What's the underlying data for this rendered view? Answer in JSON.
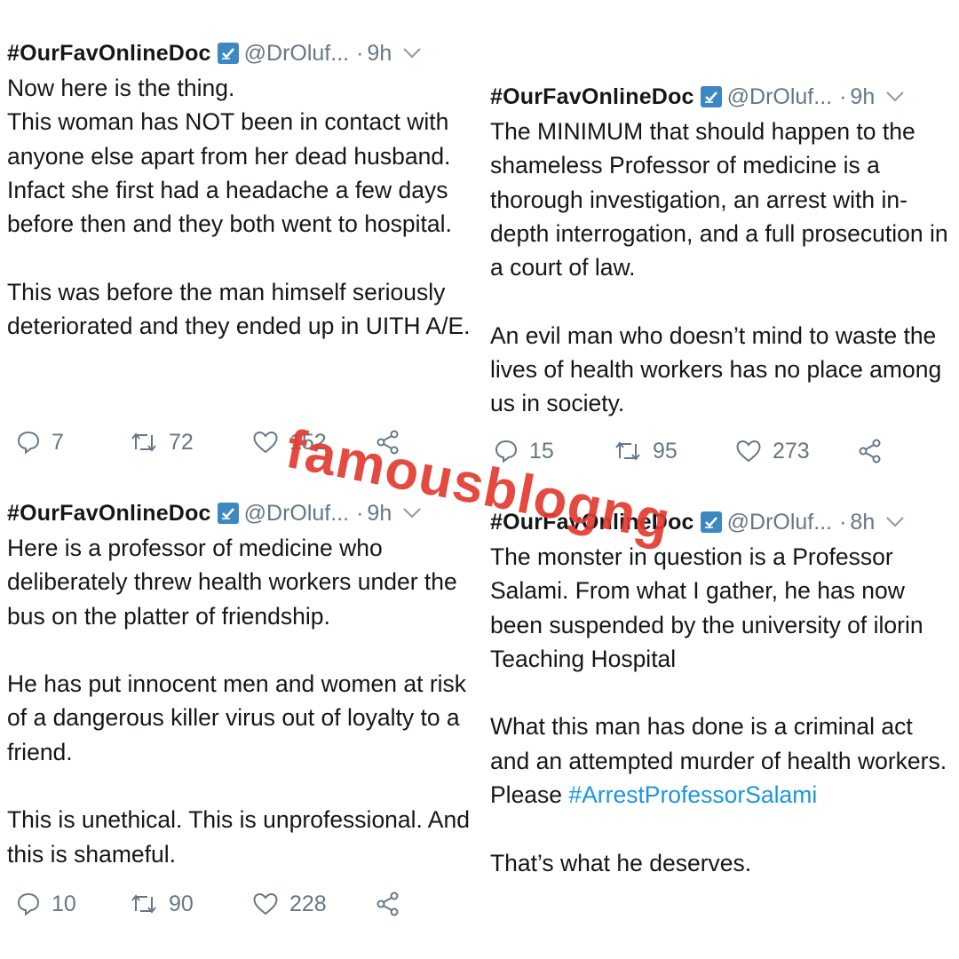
{
  "tweets": [
    {
      "name": "#OurFavOnlineDoc",
      "handle": "@DrOluf...",
      "separator": "·",
      "time": "9h",
      "paragraphs": [
        "Now here is the thing.\nThis woman has NOT been in contact with anyone else apart from her dead husband. Infact she first had a headache a few days before then and they both went to hospital.",
        "This was before the man himself seriously deteriorated and they ended up in UITH A/E."
      ],
      "replies": "7",
      "retweets": "72",
      "likes": "152"
    },
    {
      "name": "#OurFavOnlineDoc",
      "handle": "@DrOluf...",
      "separator": "·",
      "time": "9h",
      "paragraphs": [
        "The MINIMUM that should happen to the shameless Professor of medicine is a thorough investigation, an arrest with in-depth interrogation, and a full prosecution in a court of law.",
        "An evil man who doesn’t mind to waste the lives of health workers has no place among us in society."
      ],
      "replies": "15",
      "retweets": "95",
      "likes": "273"
    },
    {
      "name": "#OurFavOnlineDoc",
      "handle": "@DrOluf...",
      "separator": "·",
      "time": "9h",
      "paragraphs": [
        "Here is a professor of medicine who deliberately threw health workers under the bus on the platter of friendship.",
        "He has put innocent men and women at risk of a dangerous killer virus out of loyalty to a friend.",
        "This is unethical. This is unprofessional. And this is shameful."
      ],
      "replies": "10",
      "retweets": "90",
      "likes": "228"
    },
    {
      "name": "#OurFavOnlineDoc",
      "handle": "@DrOluf...",
      "separator": "·",
      "time": "8h",
      "paragraphs": [
        "The monster in question is a Professor Salami. From what I gather, he has now been suspended by the university of ilorin Teaching Hospital",
        "What this man has done is a criminal act and an attempted murder of health workers. Please ",
        "That’s what he deserves."
      ],
      "hashtag": "#ArrestProfessorSalami"
    }
  ],
  "watermark": "famousblogng",
  "colors": {
    "text": "#14171a",
    "muted": "#657786",
    "link": "#1b95e0",
    "badge": "#3b88c3",
    "watermark": "#e23b2f"
  },
  "icons": [
    "verified-badge-icon",
    "chevron-down-icon",
    "reply-icon",
    "retweet-icon",
    "like-icon",
    "share-icon"
  ]
}
